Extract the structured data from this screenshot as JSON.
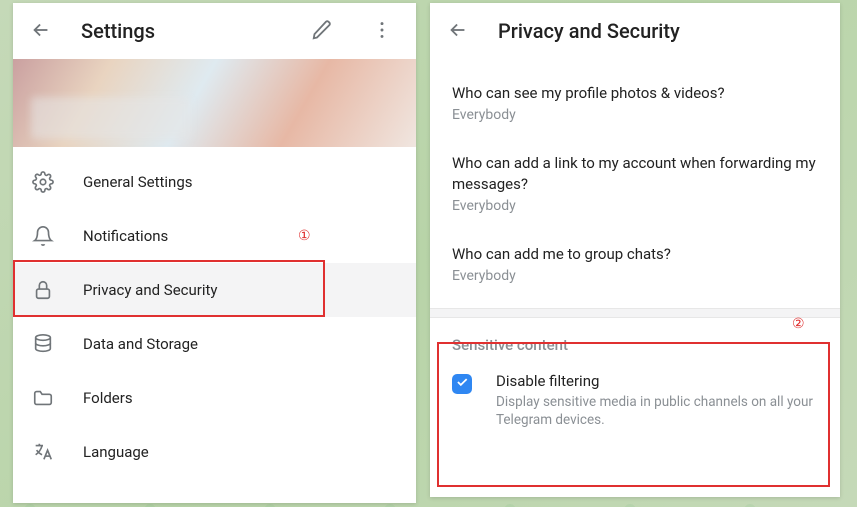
{
  "left": {
    "title": "Settings",
    "menu": [
      {
        "id": "general",
        "label": "General Settings"
      },
      {
        "id": "notif",
        "label": "Notifications"
      },
      {
        "id": "privacy",
        "label": "Privacy and Security"
      },
      {
        "id": "data",
        "label": "Data and Storage"
      },
      {
        "id": "folders",
        "label": "Folders"
      },
      {
        "id": "language",
        "label": "Language"
      }
    ],
    "selected_id": "privacy"
  },
  "right": {
    "title": "Privacy and Security",
    "privacy": [
      {
        "q": "Who can see my profile photos & videos?",
        "v": "Everybody"
      },
      {
        "q": "Who can add a link to my account when forwarding my messages?",
        "v": "Everybody"
      },
      {
        "q": "Who can add me to group chats?",
        "v": "Everybody"
      }
    ],
    "section_title": "Sensitive content",
    "disable_filtering": {
      "title": "Disable filtering",
      "desc": "Display sensitive media in public channels on all your Telegram devices.",
      "checked": true
    }
  },
  "annotations": {
    "a1": "①",
    "a2": "②"
  }
}
